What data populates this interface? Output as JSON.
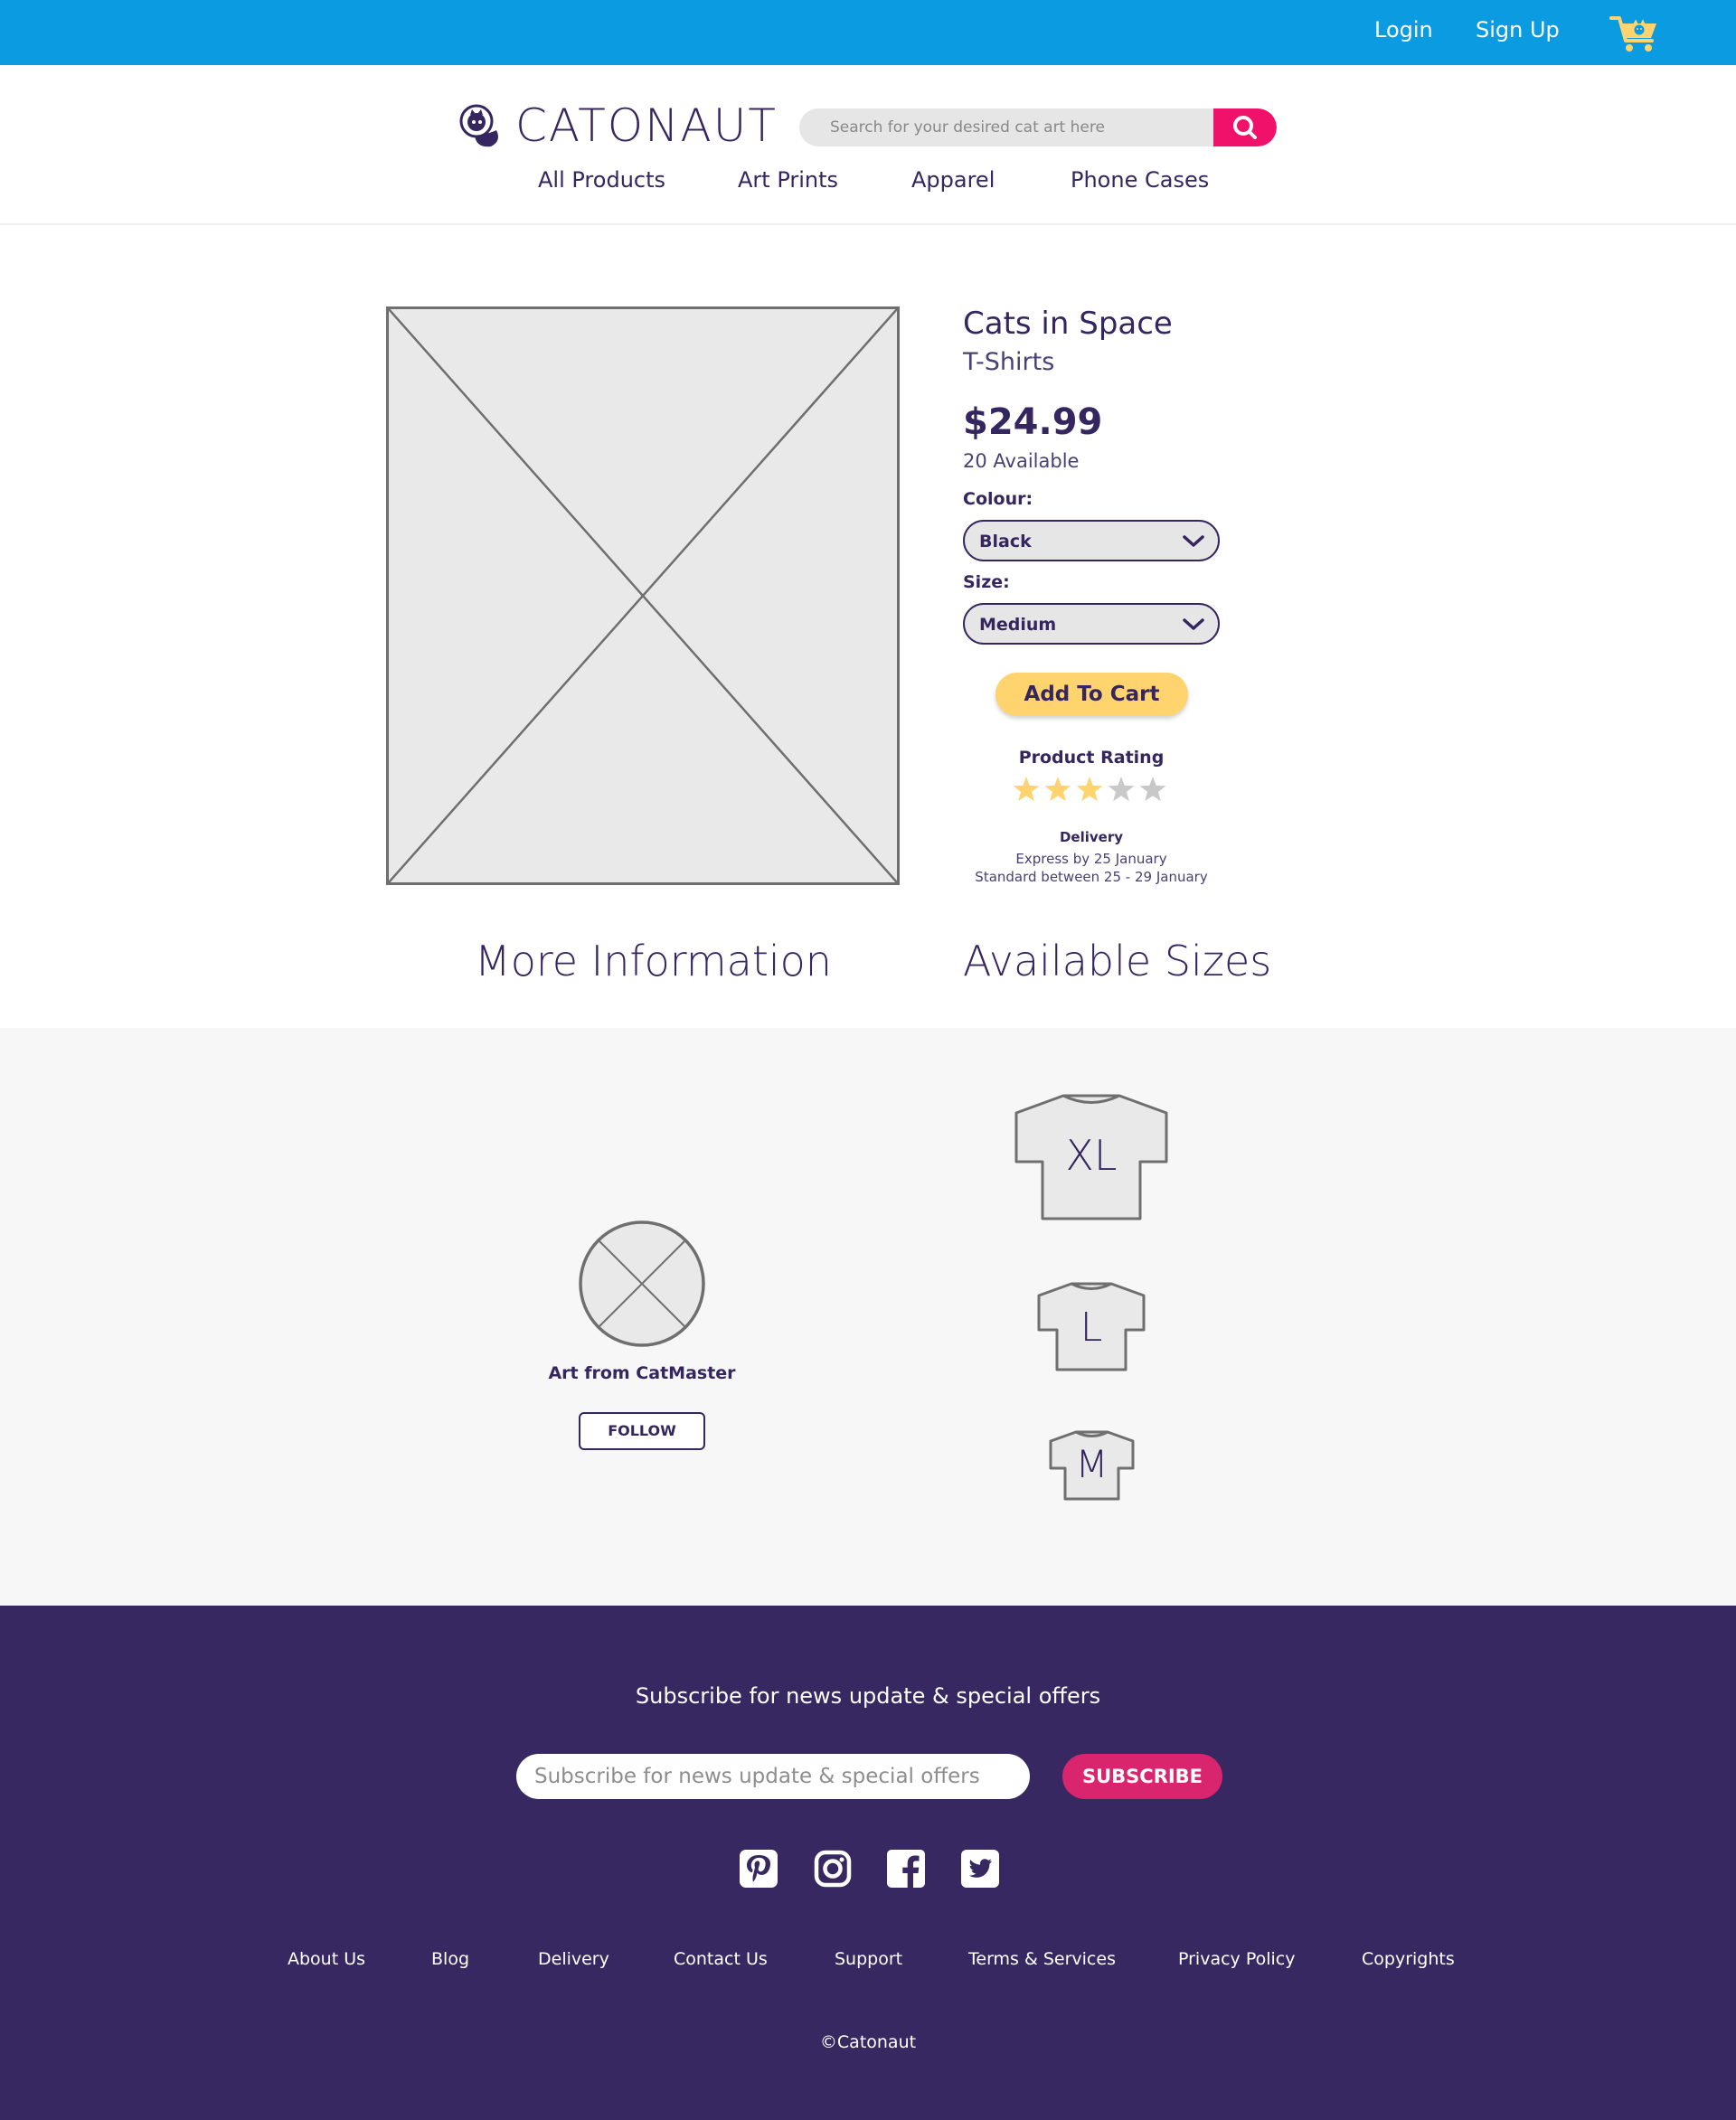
{
  "header": {
    "login_label": "Login",
    "signup_label": "Sign Up",
    "cart_icon": "cart-icon",
    "accent_color": "#0b9be0"
  },
  "brand": {
    "logo_text": "CATONAUT",
    "logo_icon": "astronaut-cat-logo",
    "search_placeholder": "Search for your desired cat art here",
    "search_icon": "search-icon"
  },
  "nav": {
    "items": [
      {
        "label": "All Products"
      },
      {
        "label": "Art Prints"
      },
      {
        "label": "Apparel"
      },
      {
        "label": "Phone Cases"
      }
    ]
  },
  "product": {
    "title": "Cats in Space",
    "category": "T-Shirts",
    "price": "$24.99",
    "availability": "20 Available",
    "colour_label": "Colour:",
    "colour_value": "Black",
    "size_label": "Size:",
    "size_value": "Medium",
    "add_to_cart_label": "Add To Cart",
    "rating_label": "Product Rating",
    "rating_value": 3,
    "rating_max": 5,
    "delivery_title": "Delivery",
    "delivery_express": "Express by 25 January",
    "delivery_standard": "Standard between 25 - 29 January"
  },
  "sections": {
    "more_info_title": "More Information",
    "sizes_title": "Available Sizes"
  },
  "artist": {
    "name": "Art from CatMaster",
    "follow_label": "FOLLOW"
  },
  "sizes": [
    "XL",
    "L",
    "M"
  ],
  "footer": {
    "subscribe_title": "Subscribe for news update & special offers",
    "subscribe_placeholder": "Subscribe for news update & special offers",
    "subscribe_button": "SUBSCRIBE",
    "social_icons": [
      "pinterest-icon",
      "instagram-icon",
      "facebook-icon",
      "twitter-icon"
    ],
    "links": [
      "About Us",
      "Blog",
      "Delivery",
      "Contact Us",
      "Support",
      "Terms & Services",
      "Privacy Policy",
      "Copyrights"
    ],
    "copyright": "©Catonaut",
    "background_color": "#372861"
  },
  "colors": {
    "primary_text": "#35265f",
    "search_button": "#f0116b",
    "cta": "#ffd36e",
    "subscribe_button": "#d9256e",
    "star_filled": "#ffd36e",
    "star_empty": "#c8c8c8"
  }
}
